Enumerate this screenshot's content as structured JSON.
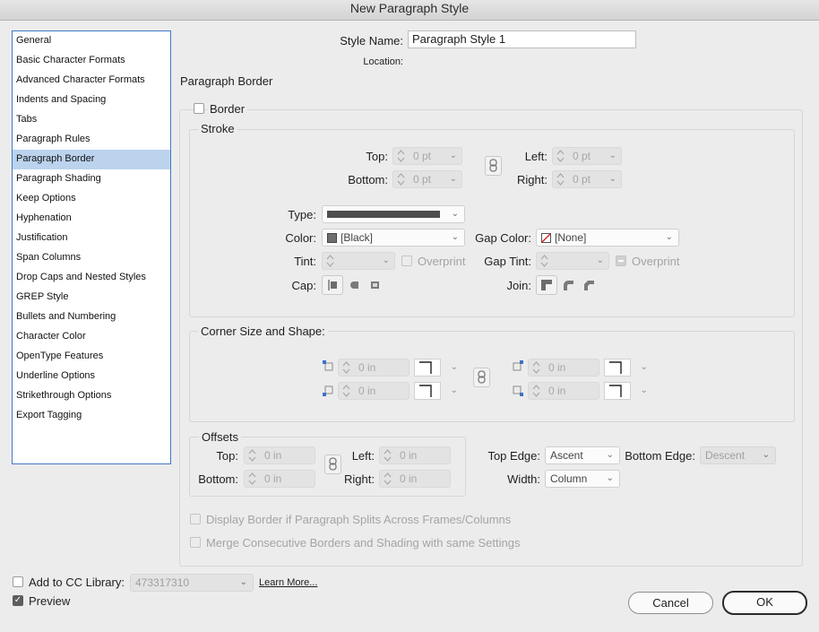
{
  "window": {
    "title": "New Paragraph Style"
  },
  "sidebar": {
    "items": [
      "General",
      "Basic Character Formats",
      "Advanced Character Formats",
      "Indents and Spacing",
      "Tabs",
      "Paragraph Rules",
      "Paragraph Border",
      "Paragraph Shading",
      "Keep Options",
      "Hyphenation",
      "Justification",
      "Span Columns",
      "Drop Caps and Nested Styles",
      "GREP Style",
      "Bullets and Numbering",
      "Character Color",
      "OpenType Features",
      "Underline Options",
      "Strikethrough Options",
      "Export Tagging"
    ],
    "selected": "Paragraph Border"
  },
  "header": {
    "style_name_label": "Style Name:",
    "style_name_value": "Paragraph Style 1",
    "location_label": "Location:"
  },
  "section": {
    "title": "Paragraph Border",
    "border_label": "Border"
  },
  "stroke": {
    "legend": "Stroke",
    "top_label": "Top:",
    "top_value": "0 pt",
    "bottom_label": "Bottom:",
    "bottom_value": "0 pt",
    "left_label": "Left:",
    "left_value": "0 pt",
    "right_label": "Right:",
    "right_value": "0 pt",
    "type_label": "Type:",
    "color_label": "Color:",
    "color_value": "[Black]",
    "gap_color_label": "Gap Color:",
    "gap_color_value": "[None]",
    "tint_label": "Tint:",
    "overprint_label": "Overprint",
    "gap_tint_label": "Gap Tint:",
    "gap_overprint_label": "Overprint",
    "cap_label": "Cap:",
    "join_label": "Join:"
  },
  "corner": {
    "legend": "Corner Size and Shape:",
    "tl_value": "0 in",
    "bl_value": "0 in",
    "tr_value": "0 in",
    "br_value": "0 in"
  },
  "offsets": {
    "legend": "Offsets",
    "top_label": "Top:",
    "top_value": "0 in",
    "bottom_label": "Bottom:",
    "bottom_value": "0 in",
    "left_label": "Left:",
    "left_value": "0 in",
    "right_label": "Right:",
    "right_value": "0 in"
  },
  "edges": {
    "top_edge_label": "Top Edge:",
    "top_edge_value": "Ascent",
    "bottom_edge_label": "Bottom Edge:",
    "bottom_edge_value": "Descent",
    "width_label": "Width:",
    "width_value": "Column"
  },
  "options": {
    "split_label": "Display Border if Paragraph Splits Across Frames/Columns",
    "merge_label": "Merge Consecutive Borders and Shading with same Settings"
  },
  "footer": {
    "cc_label": "Add to CC Library:",
    "cc_value": "473317310",
    "learn_more": "Learn More...",
    "preview_label": "Preview",
    "cancel_label": "Cancel",
    "ok_label": "OK"
  },
  "colors": {
    "accent": "#3f79c8",
    "selection": "#bcd3ee",
    "dialog_bg": "#ececec"
  }
}
